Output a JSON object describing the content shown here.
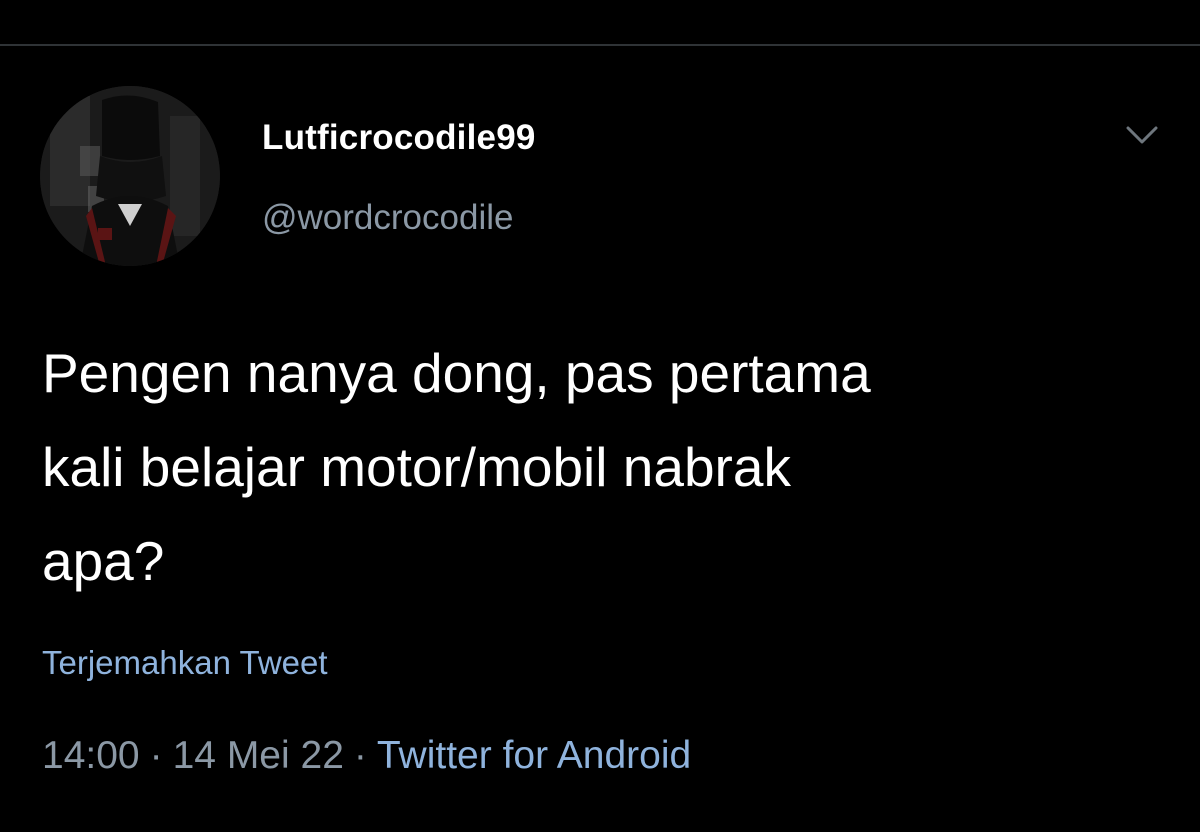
{
  "tweet": {
    "author": {
      "display_name": "Lutficrocodile99",
      "handle": "@wordcrocodile"
    },
    "text_lines": [
      "Pengen nanya dong, pas pertama",
      "kali belajar motor/mobil nabrak",
      "apa?"
    ],
    "translate_label": "Terjemahkan Tweet",
    "meta": {
      "time": "14:00",
      "separator": "·",
      "date": "14 Mei 22",
      "source": "Twitter for Android"
    },
    "icons": {
      "menu": "chevron-down-icon",
      "avatar": "profile-photo"
    }
  },
  "colors": {
    "background": "#000000",
    "primary_text": "#ffffff",
    "secondary_text": "#8b98a5",
    "link": "#8fb3dd",
    "divider": "#2f3336"
  }
}
